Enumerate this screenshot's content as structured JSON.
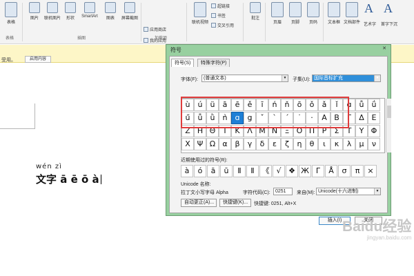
{
  "ribbon": {
    "buttons": [
      {
        "label": "表格"
      },
      {
        "label": "图片"
      },
      {
        "label": "联机图片"
      },
      {
        "label": "形状"
      },
      {
        "label": "SmartArt"
      },
      {
        "label": "图表"
      },
      {
        "label": "屏幕截图"
      },
      {
        "label": "联机视频"
      },
      {
        "label": "批注"
      },
      {
        "label": "页眉"
      },
      {
        "label": "页脚"
      },
      {
        "label": "页码"
      },
      {
        "label": "文本框"
      },
      {
        "label": "文档部件"
      },
      {
        "label": "艺术字"
      },
      {
        "label": "首字下沉"
      }
    ],
    "small_items": [
      {
        "label": "应用商店"
      },
      {
        "label": "我的应用"
      },
      {
        "label": "超链接"
      },
      {
        "label": "书签"
      },
      {
        "label": "交叉引用"
      }
    ],
    "groups": [
      {
        "label": "表格"
      },
      {
        "label": "插图"
      },
      {
        "label": "加载项"
      }
    ]
  },
  "infobar": {
    "text": "受用。",
    "button": "启用内容"
  },
  "document": {
    "pinyin": "wén zì",
    "text": "文字 ā ē ō à"
  },
  "dialog": {
    "title": "符号",
    "close": "✕",
    "tabs": [
      {
        "label": "符号(S)"
      },
      {
        "label": "特殊字符(P)"
      }
    ],
    "font_label": "字体(F):",
    "font_value": "(普通文本)",
    "subset_label": "子集(U):",
    "subset_value": "国际音标扩充",
    "grid_rows": [
      [
        "ù",
        "ú",
        "ü",
        "ā",
        "ē",
        "ě",
        "ī",
        "ń",
        "ň",
        "ō",
        "ǒ",
        "ǎ",
        "ǐ",
        "ɑ",
        "ǚ",
        "ǘ"
      ],
      [
        "ű",
        "ǚ",
        "ǜ",
        "ǹ",
        "ɑ",
        "g",
        "ˇ",
        "ˋ",
        "ˊ",
        "˙",
        "·",
        "A",
        "B",
        "Γ",
        "Δ",
        "E"
      ],
      [
        "Z",
        "H",
        "Θ",
        "I",
        "K",
        "Λ",
        "M",
        "N",
        "Ξ",
        "Ο",
        "Π",
        "P",
        "Σ",
        "T",
        "Y",
        "Φ"
      ],
      [
        "X",
        "Ψ",
        "Ω",
        "α",
        "β",
        "γ",
        "δ",
        "ε",
        "ζ",
        "η",
        "θ",
        "ι",
        "κ",
        "λ",
        "μ",
        "ν"
      ]
    ],
    "recent_label": "近期使用过的符号(R):",
    "recent": [
      "à",
      "ó",
      "ā",
      "ū",
      "Ⅱ",
      "Ⅱ",
      "《",
      "√",
      "❖",
      "Ж",
      "Γ",
      "Å",
      "σ",
      "π",
      "×"
    ],
    "unicode_name_label": "Unicode 名称:",
    "unicode_name": "拉丁文小写字母 Alpha",
    "char_code_label": "字符代码(C):",
    "char_code": "0251",
    "from_label": "来自(M):",
    "from_value": "Unicode(十六进制)",
    "autocorrect_btn": "自动更正(A)...",
    "shortcut_btn": "快捷键(K)...",
    "shortcut_text": "快捷键: 0251, Alt+X",
    "insert_btn": "插入(I)",
    "close_btn": "关闭"
  },
  "watermark": {
    "main": "Baidu经验",
    "sub": "jingyan.baidu.com"
  }
}
